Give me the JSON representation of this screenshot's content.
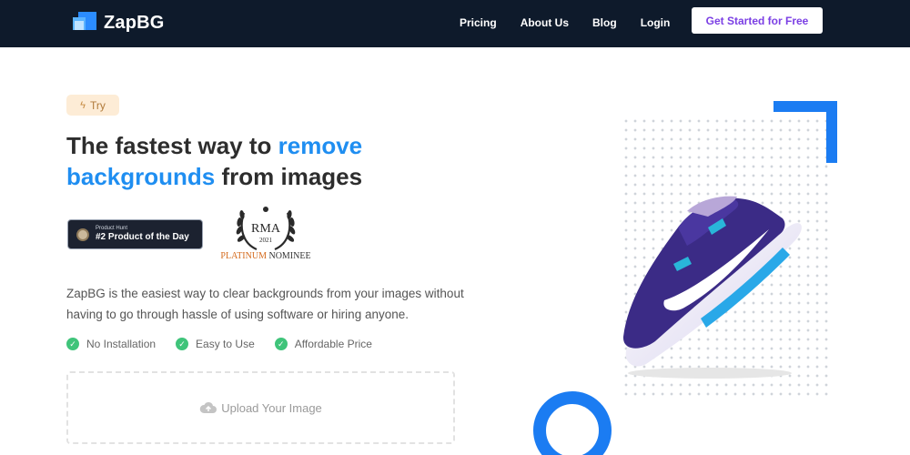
{
  "app": {
    "logo_text": "ZapBG"
  },
  "nav": {
    "links": [
      "Pricing",
      "About Us",
      "Blog",
      "Login"
    ],
    "cta_label": "Get Started for Free"
  },
  "hero": {
    "badge_label": "Try",
    "headline": {
      "part1": "The fastest way to ",
      "highlight1": "remove",
      "highlight2": "backgrounds",
      "part2": " from images"
    },
    "product_hunt": {
      "small": "Product Hunt",
      "big": "#2 Product of the Day"
    },
    "award": {
      "platinum": "PLATINUM",
      "nominee": "NOMINEE"
    },
    "description": "ZapBG is the easiest way to clear backgrounds from your images without having to go through hassle of using software or hiring anyone.",
    "features": [
      "No Installation",
      "Easy to Use",
      "Affordable Price"
    ],
    "upload_label": "Upload Your Image"
  },
  "colors": {
    "nav_bg": "#0e1a2b",
    "accent_blue": "#1f8ef1",
    "cta_text": "#7b3fe4",
    "check_green": "#3fc47a"
  },
  "icons": {
    "badge": "lightning-icon",
    "feature": "check-circle-icon",
    "upload": "cloud-upload-icon"
  }
}
